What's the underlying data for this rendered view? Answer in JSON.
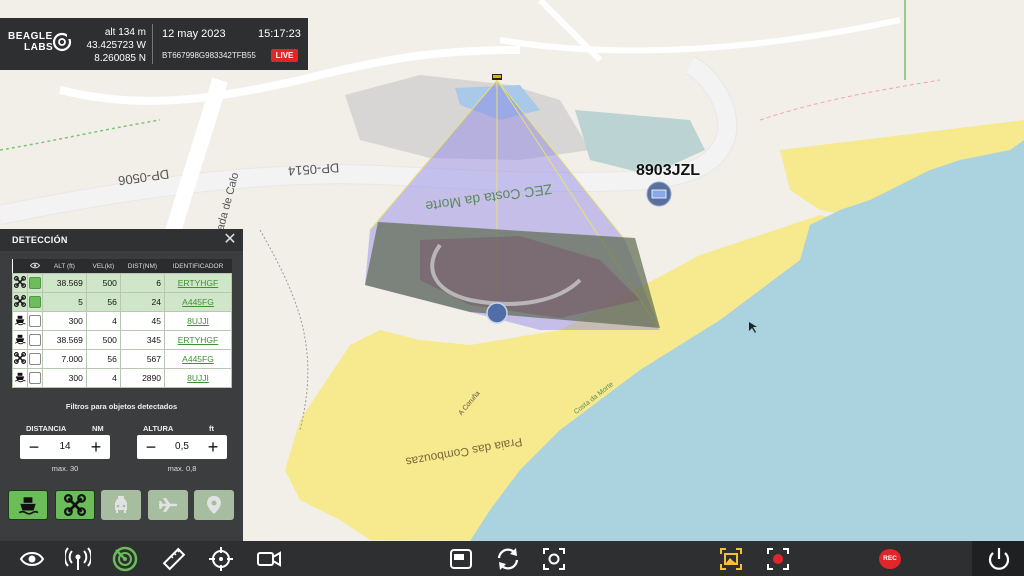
{
  "header": {
    "logo_line1": "BEAGLE",
    "logo_line2": "LABS",
    "alt": "alt 134 m",
    "lat": "43.425723 W",
    "lon": "8.260085 N",
    "date": "12 may 2023",
    "time": "15:17:23",
    "serial": "BT667998G983342TFB55",
    "live_badge": "LIVE"
  },
  "map": {
    "labels": {
      "road1": "DP-0506",
      "road2": "DP-0514",
      "road3": "Estrada de Calo",
      "zec": "ZEC Costa da Morte",
      "tag": "8903JZL",
      "beach": "Praia das Combouzas",
      "coast": "A Coruña",
      "region": "Costa da Morte"
    }
  },
  "panel": {
    "title": "DETECCIÓN",
    "columns": [
      "",
      "",
      "ALT (ft)",
      "VEL(kt)",
      "DIST(NM)",
      "IDENTIFICADOR"
    ],
    "rows": [
      {
        "type": "drone-icon",
        "checked": true,
        "alt": "38.569",
        "vel": "500",
        "dist": "6",
        "id": "ERTYHGF",
        "selected": true
      },
      {
        "type": "drone-icon",
        "checked": true,
        "alt": "5",
        "vel": "56",
        "dist": "24",
        "id": "A445FG",
        "selected": true
      },
      {
        "type": "ship-icon",
        "checked": false,
        "alt": "300",
        "vel": "4",
        "dist": "45",
        "id": "8UJJI",
        "selected": false
      },
      {
        "type": "ship-icon",
        "checked": false,
        "alt": "38.569",
        "vel": "500",
        "dist": "345",
        "id": "ERTYHGF",
        "selected": false
      },
      {
        "type": "drone-icon",
        "checked": false,
        "alt": "7.000",
        "vel": "56",
        "dist": "567",
        "id": "A445FG",
        "selected": false
      },
      {
        "type": "ship-icon",
        "checked": false,
        "alt": "300",
        "vel": "4",
        "dist": "2890",
        "id": "8UJJI",
        "selected": false
      }
    ],
    "filters_title": "Filtros para objetos detectados",
    "distance": {
      "label": "DISTANCIA",
      "unit": "NM",
      "value": "14",
      "max": "max. 30"
    },
    "height": {
      "label": "ALTURA",
      "unit": "ft",
      "value": "0,5",
      "max": "max. 0,8"
    },
    "types": [
      {
        "icon": "ship-icon",
        "active": true
      },
      {
        "icon": "drone-icon",
        "active": true
      },
      {
        "icon": "car-icon",
        "active": false
      },
      {
        "icon": "plane-icon",
        "active": false
      },
      {
        "icon": "location-pin-icon",
        "active": false
      }
    ]
  },
  "toolbar": {
    "rec_label": "REC",
    "icons": [
      "eye-icon",
      "antenna-icon",
      "radar-icon",
      "ruler-icon",
      "crosshair-icon",
      "video-camera-icon",
      "window-icon",
      "sync-icon",
      "focus-icon",
      "picture-in-picture-icon",
      "record-frame-icon",
      "rec-button",
      "power-icon"
    ]
  },
  "colors": {
    "accent_green": "#6bbd59",
    "live_red": "#e0262b",
    "panel_bg": "#3b3d3f",
    "sea": "#aad3df",
    "sand": "#f7e98e"
  }
}
